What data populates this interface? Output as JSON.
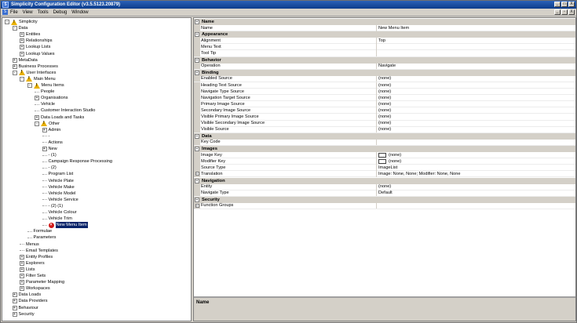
{
  "window": {
    "title": "Simplicity Configuration Editor (v3.5.5123.20879)",
    "app_icon": "S",
    "controls": [
      "_",
      "□",
      "X"
    ]
  },
  "menubar": {
    "items": [
      "File",
      "View",
      "Tools",
      "Debug",
      "Window"
    ],
    "mdi_controls": [
      "_",
      "▫",
      "X"
    ]
  },
  "tree": {
    "nodes": [
      {
        "label": "Simplicity",
        "toggle": "-",
        "icon": "warning",
        "level": 0
      },
      {
        "label": "Data",
        "toggle": "-",
        "icon": "none",
        "level": 1
      },
      {
        "label": "Entities",
        "toggle": "+",
        "icon": "none",
        "level": 2
      },
      {
        "label": "Relationships",
        "toggle": "+",
        "icon": "none",
        "level": 2
      },
      {
        "label": "Lookup Lists",
        "toggle": "+",
        "icon": "none",
        "level": 2
      },
      {
        "label": "Lookup Values",
        "toggle": "+",
        "icon": "none",
        "level": 2
      },
      {
        "label": "MetaData",
        "toggle": "+",
        "icon": "none",
        "level": 1
      },
      {
        "label": "Business Processes",
        "toggle": "+",
        "icon": "none",
        "level": 1
      },
      {
        "label": "User Interfaces",
        "toggle": "-",
        "icon": "warning",
        "level": 1
      },
      {
        "label": "Main Menu",
        "toggle": "-",
        "icon": "warning",
        "level": 2
      },
      {
        "label": "Menu Items",
        "toggle": "-",
        "icon": "warning",
        "level": 3
      },
      {
        "label": "People",
        "toggle": "",
        "icon": "none",
        "level": 4
      },
      {
        "label": "Organisations",
        "toggle": "+",
        "icon": "none",
        "level": 4
      },
      {
        "label": "Vehicle",
        "toggle": "",
        "icon": "none",
        "level": 4
      },
      {
        "label": "Customer Interaction Studio",
        "toggle": "",
        "icon": "none",
        "level": 4
      },
      {
        "label": "Data Loads and Tasks",
        "toggle": "+",
        "icon": "none",
        "level": 4
      },
      {
        "label": "Other",
        "toggle": "-",
        "icon": "warning",
        "level": 4
      },
      {
        "label": "Admin",
        "toggle": "+",
        "icon": "none",
        "level": 5
      },
      {
        "label": "-",
        "toggle": "",
        "icon": "none",
        "level": 5
      },
      {
        "label": "Actions",
        "toggle": "",
        "icon": "none",
        "level": 5
      },
      {
        "label": "New",
        "toggle": "+",
        "icon": "none",
        "level": 5
      },
      {
        "label": "- (1)",
        "toggle": "",
        "icon": "none",
        "level": 5
      },
      {
        "label": "Campaign Response Processing",
        "toggle": "",
        "icon": "none",
        "level": 5
      },
      {
        "label": "- (2)",
        "toggle": "",
        "icon": "none",
        "level": 5
      },
      {
        "label": "Program List",
        "toggle": "",
        "icon": "none",
        "level": 5
      },
      {
        "label": "Vehicle Plate",
        "toggle": "",
        "icon": "none",
        "level": 5
      },
      {
        "label": "Vehicle Make",
        "toggle": "",
        "icon": "none",
        "level": 5
      },
      {
        "label": "Vehicle Model",
        "toggle": "",
        "icon": "none",
        "level": 5
      },
      {
        "label": "Vehicle Service",
        "toggle": "",
        "icon": "none",
        "level": 5
      },
      {
        "label": "- (2) (1)",
        "toggle": "",
        "icon": "none",
        "level": 5
      },
      {
        "label": "Vehicle Colour",
        "toggle": "",
        "icon": "none",
        "level": 5
      },
      {
        "label": "Vehicle Trim",
        "toggle": "",
        "icon": "none",
        "level": 5
      },
      {
        "label": "New Menu Item",
        "toggle": "",
        "icon": "error",
        "level": 5,
        "selected": true
      },
      {
        "label": "Formulae",
        "toggle": "",
        "icon": "none",
        "level": 3
      },
      {
        "label": "Parameters",
        "toggle": "",
        "icon": "none",
        "level": 3
      },
      {
        "label": "Menus",
        "toggle": "",
        "icon": "none",
        "level": 2
      },
      {
        "label": "Email Templates",
        "toggle": "",
        "icon": "none",
        "level": 2
      },
      {
        "label": "Entity Profiles",
        "toggle": "+",
        "icon": "none",
        "level": 2
      },
      {
        "label": "Explorers",
        "toggle": "+",
        "icon": "none",
        "level": 2
      },
      {
        "label": "Lists",
        "toggle": "+",
        "icon": "none",
        "level": 2
      },
      {
        "label": "Filter Sets",
        "toggle": "+",
        "icon": "none",
        "level": 2
      },
      {
        "label": "Parameter Mapping",
        "toggle": "+",
        "icon": "none",
        "level": 2
      },
      {
        "label": "Workspaces",
        "toggle": "+",
        "icon": "none",
        "level": 2
      },
      {
        "label": "Data Loads",
        "toggle": "+",
        "icon": "none",
        "level": 1
      },
      {
        "label": "Data Providers",
        "toggle": "+",
        "icon": "none",
        "level": 1
      },
      {
        "label": "Behaviour",
        "toggle": "+",
        "icon": "none",
        "level": 1
      },
      {
        "label": "Security",
        "toggle": "+",
        "icon": "none",
        "level": 1
      }
    ]
  },
  "properties": {
    "rows": [
      {
        "kind": "category",
        "label": "Name"
      },
      {
        "kind": "prop",
        "name": "Name",
        "value": "New Menu Item"
      },
      {
        "kind": "category",
        "label": "Appearance"
      },
      {
        "kind": "prop",
        "name": "Alignment",
        "value": "Top"
      },
      {
        "kind": "prop",
        "name": "Menu Text",
        "value": ""
      },
      {
        "kind": "prop",
        "name": "Tool Tip",
        "value": ""
      },
      {
        "kind": "category",
        "label": "Behavior"
      },
      {
        "kind": "prop",
        "name": "Operation",
        "value": "Navigate"
      },
      {
        "kind": "category",
        "label": "Binding"
      },
      {
        "kind": "prop",
        "name": "Enabled Source",
        "value": "(none)"
      },
      {
        "kind": "prop",
        "name": "Heading Text Source",
        "value": "(none)"
      },
      {
        "kind": "prop",
        "name": "Navigate Type Source",
        "value": "(none)"
      },
      {
        "kind": "prop",
        "name": "Navigation Target Source",
        "value": "(none)"
      },
      {
        "kind": "prop",
        "name": "Primary Image Source",
        "value": "(none)"
      },
      {
        "kind": "prop",
        "name": "Secondary Image Source",
        "value": "(none)"
      },
      {
        "kind": "prop",
        "name": "Visible Primary Image Source",
        "value": "(none)"
      },
      {
        "kind": "prop",
        "name": "Visible Secondary Image Source",
        "value": "(none)"
      },
      {
        "kind": "prop",
        "name": "Visible Source",
        "value": "(none)"
      },
      {
        "kind": "category",
        "label": "Data"
      },
      {
        "kind": "prop",
        "name": "Key Code",
        "value": ""
      },
      {
        "kind": "category",
        "label": "Images"
      },
      {
        "kind": "prop",
        "name": "Image Key",
        "value": "(none)",
        "swatch": true
      },
      {
        "kind": "prop",
        "name": "Modifier Key",
        "value": "(none)",
        "swatch": true
      },
      {
        "kind": "prop",
        "name": "Source Type",
        "value": "ImageList"
      },
      {
        "kind": "prop",
        "name": "Translation",
        "value": "Image: None, None; Modifier: None, None",
        "expandable": true
      },
      {
        "kind": "category",
        "label": "Navigation"
      },
      {
        "kind": "prop",
        "name": "Entity",
        "value": "(none)"
      },
      {
        "kind": "prop",
        "name": "Navigate Type",
        "value": "Default"
      },
      {
        "kind": "category",
        "label": "Security"
      },
      {
        "kind": "prop",
        "name": "Function Groups",
        "value": "",
        "expandable": true
      }
    ]
  },
  "description": {
    "title": "Name"
  }
}
